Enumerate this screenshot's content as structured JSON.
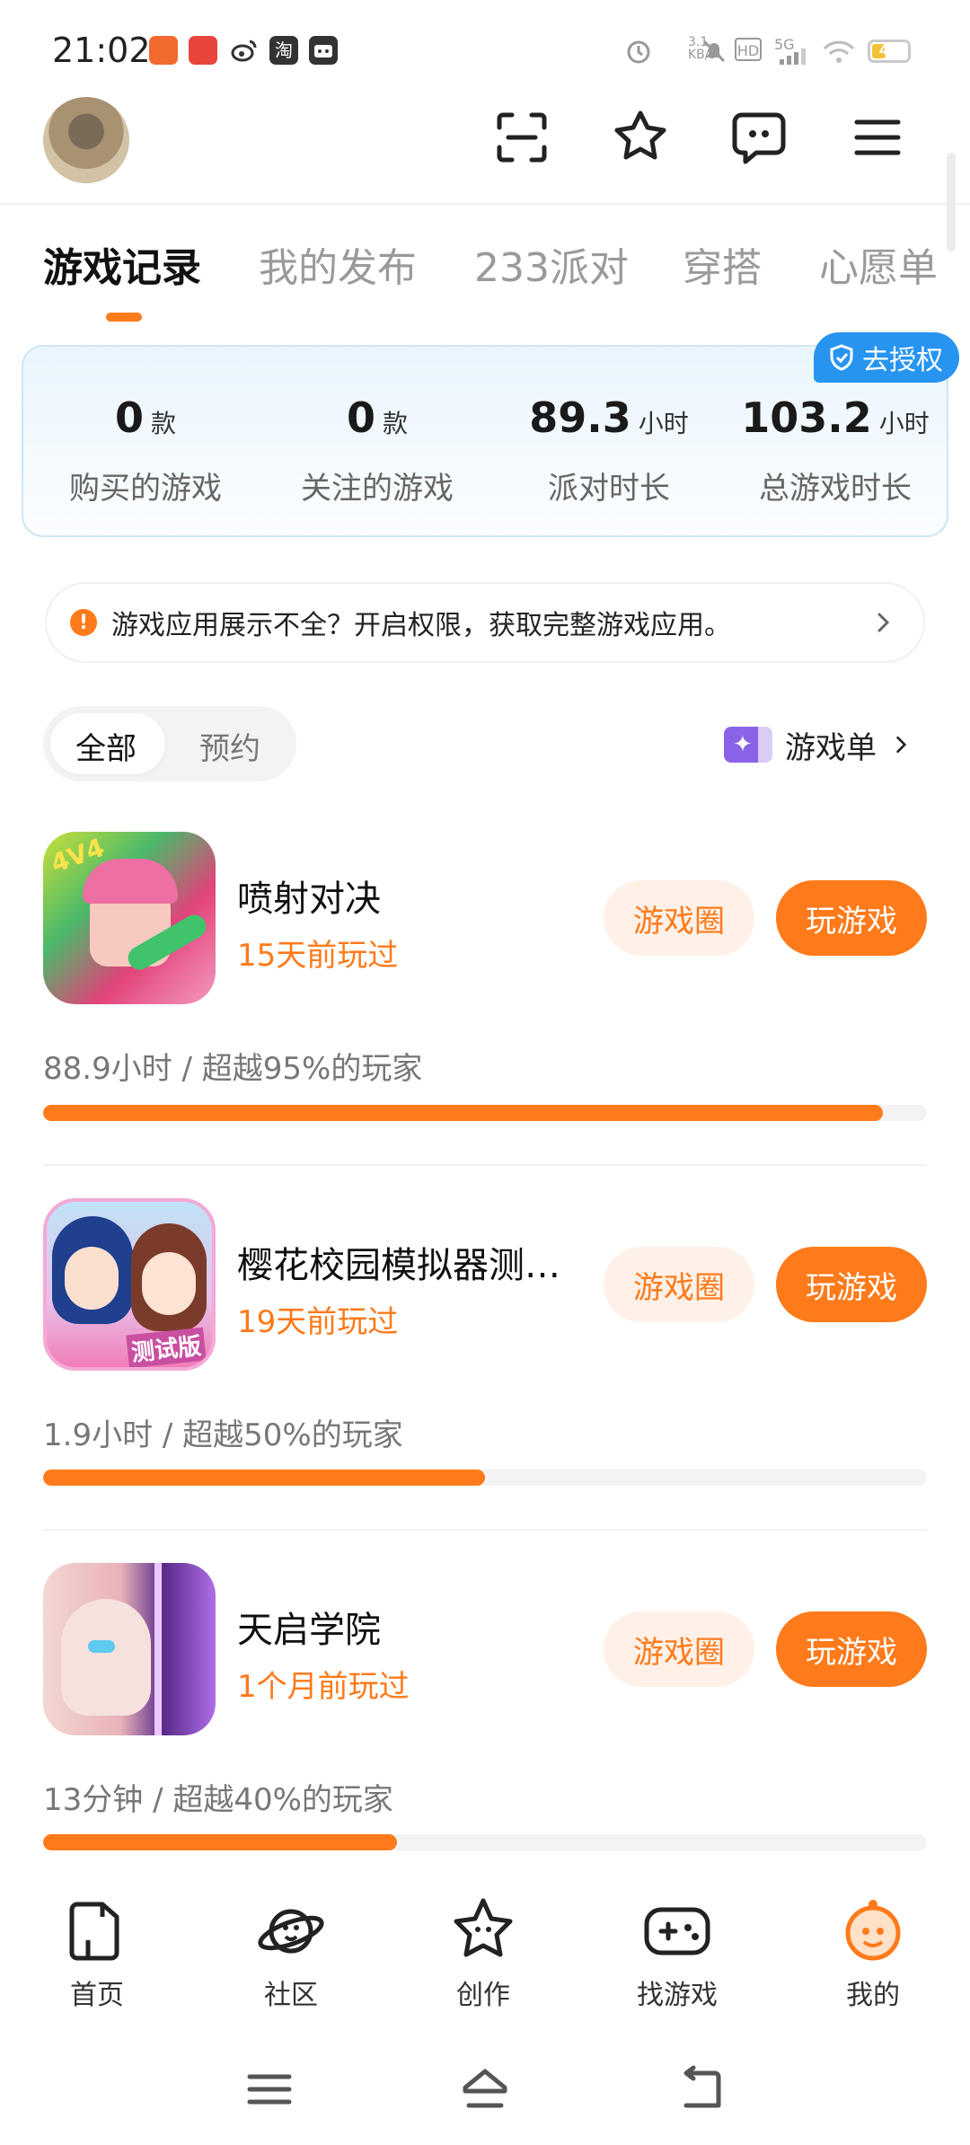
{
  "status_bar": {
    "time": "21:02",
    "speed": "3.1 KB/s",
    "hd": "HD",
    "network": "5G",
    "battery": "45",
    "battery_level": 0.45
  },
  "header": {
    "icons": [
      "scan-icon",
      "star-icon",
      "message-icon",
      "menu-icon"
    ]
  },
  "tabs": [
    {
      "label": "游戏记录",
      "active": true
    },
    {
      "label": "我的发布"
    },
    {
      "label": "233派对"
    },
    {
      "label": "穿搭"
    },
    {
      "label": "心愿单"
    }
  ],
  "stats": {
    "auth_badge": "去授权",
    "items": [
      {
        "value": "0",
        "unit": "款",
        "label": "购买的游戏"
      },
      {
        "value": "0",
        "unit": "款",
        "label": "关注的游戏"
      },
      {
        "value": "89.3",
        "unit": "小时",
        "label": "派对时长"
      },
      {
        "value": "103.2",
        "unit": "小时",
        "label": "总游戏时长"
      }
    ]
  },
  "notice": {
    "text": "游戏应用展示不全？开启权限，获取完整游戏应用。"
  },
  "filter": {
    "options": [
      "全部",
      "预约"
    ],
    "selected": "全部",
    "game_list_label": "游戏单"
  },
  "games": [
    {
      "name": "喷射对决",
      "last_played": "15天前玩过",
      "circle_label": "游戏圈",
      "play_label": "玩游戏",
      "stat": "88.9小时 / 超越95%的玩家",
      "percentile": 0.95
    },
    {
      "name": "樱花校园模拟器测…",
      "last_played": "19天前玩过",
      "circle_label": "游戏圈",
      "play_label": "玩游戏",
      "stat": "1.9小时 / 超越50%的玩家",
      "percentile": 0.5
    },
    {
      "name": "天启学院",
      "last_played": "1个月前玩过",
      "circle_label": "游戏圈",
      "play_label": "玩游戏",
      "stat": "13分钟 / 超越40%的玩家",
      "percentile": 0.4
    }
  ],
  "bottom_nav": [
    {
      "label": "首页",
      "icon": "home-icon"
    },
    {
      "label": "社区",
      "icon": "planet-icon"
    },
    {
      "label": "创作",
      "icon": "create-star-icon"
    },
    {
      "label": "找游戏",
      "icon": "gamepad-icon"
    },
    {
      "label": "我的",
      "icon": "profile-icon",
      "active": true
    }
  ],
  "colors": {
    "accent": "#ff7a1a",
    "accent_light": "#fff1e8",
    "auth_blue": "#2794f0"
  }
}
